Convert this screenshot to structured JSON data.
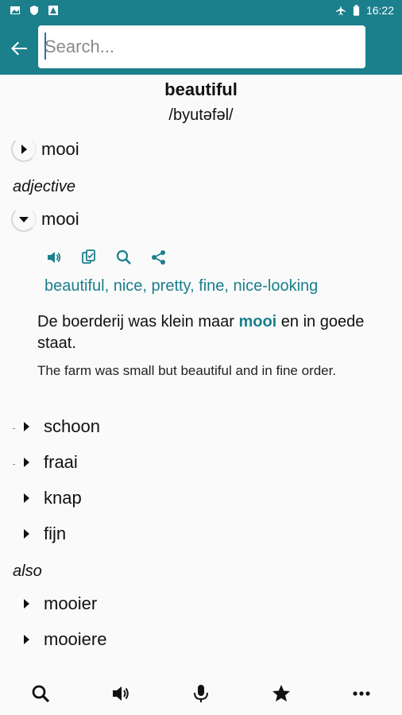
{
  "status_bar": {
    "time": "16:22",
    "left_icons": [
      "image-icon",
      "shield-icon",
      "warning-icon"
    ],
    "right_icons": [
      "airplane-icon",
      "battery-icon"
    ]
  },
  "search": {
    "placeholder": "Search...",
    "value": ""
  },
  "entry": {
    "headword": "beautiful",
    "pronunciation": "/byutəfəl/",
    "first_translation": "mooi",
    "part_of_speech": "adjective",
    "expanded_translation": "mooi",
    "synonyms": "beautiful, nice, pretty, fine, nice-looking",
    "example_nl_before": "De boerderij was klein maar ",
    "example_nl_highlight": "mooi",
    "example_nl_after": " en in goede staat.",
    "example_en": "The farm was small but beautiful and in fine order.",
    "other_translations": [
      "schoon",
      "fraai",
      "knap",
      "fijn"
    ],
    "also_label": "also",
    "also_items": [
      "mooier",
      "mooiere"
    ]
  },
  "colors": {
    "accent": "#1b7f8c"
  },
  "bottom_nav": [
    "search-icon",
    "speaker-icon",
    "microphone-icon",
    "star-icon",
    "more-icon"
  ]
}
